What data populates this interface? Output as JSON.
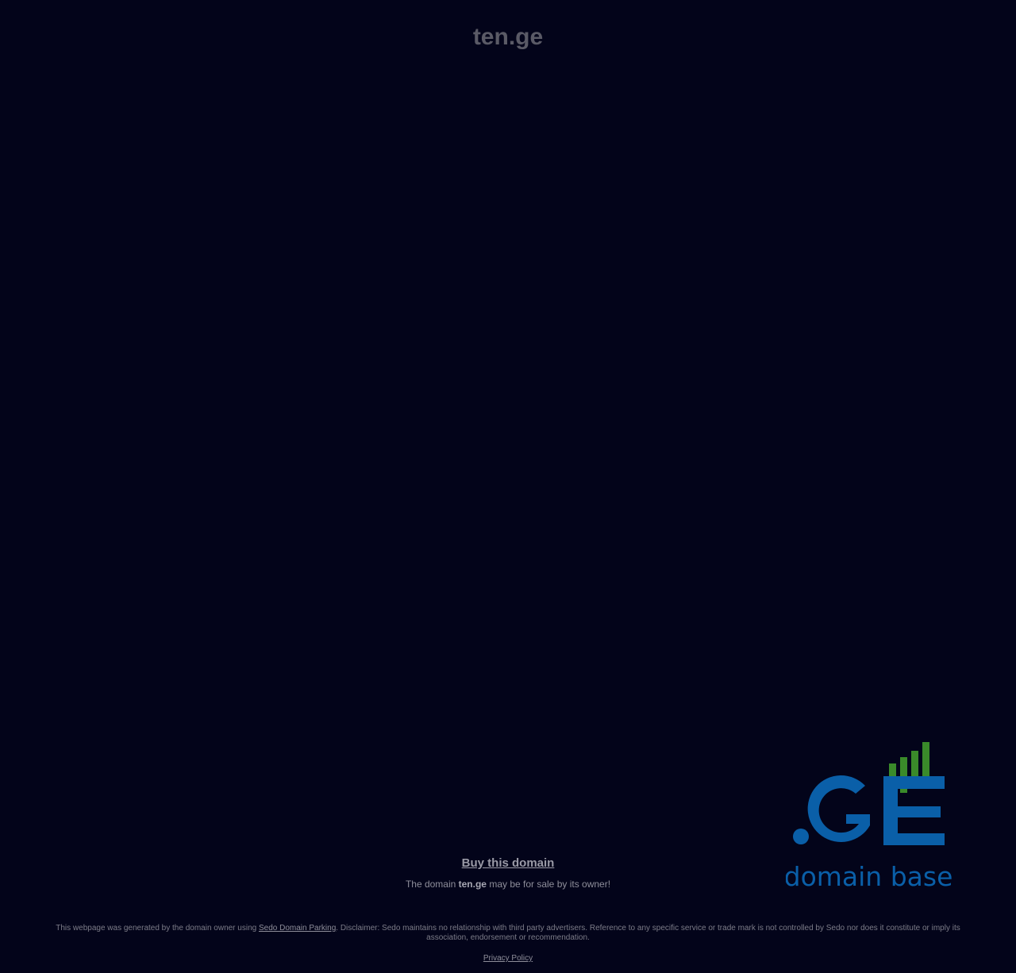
{
  "header": {
    "domain_title": "ten.ge"
  },
  "logo": {
    "text": ".GE",
    "subtitle": "domain base",
    "blue": "#0a5fa8",
    "green": "#3a8a2a"
  },
  "sale": {
    "buy_label": "Buy this domain",
    "text_prefix": "The domain ",
    "domain": "ten.ge",
    "text_suffix": " may be for sale by its owner!"
  },
  "footer": {
    "disclaimer_prefix": "This webpage was generated by the domain owner using ",
    "parking_link": "Sedo Domain Parking",
    "disclaimer_suffix": ". Disclaimer: Sedo maintains no relationship with third party advertisers. Reference to any specific service or trade mark is not controlled by Sedo nor does it constitute or imply its association, endorsement or recommendation.",
    "privacy_label": "Privacy Policy"
  },
  "colors": {
    "background": "#03041a"
  }
}
